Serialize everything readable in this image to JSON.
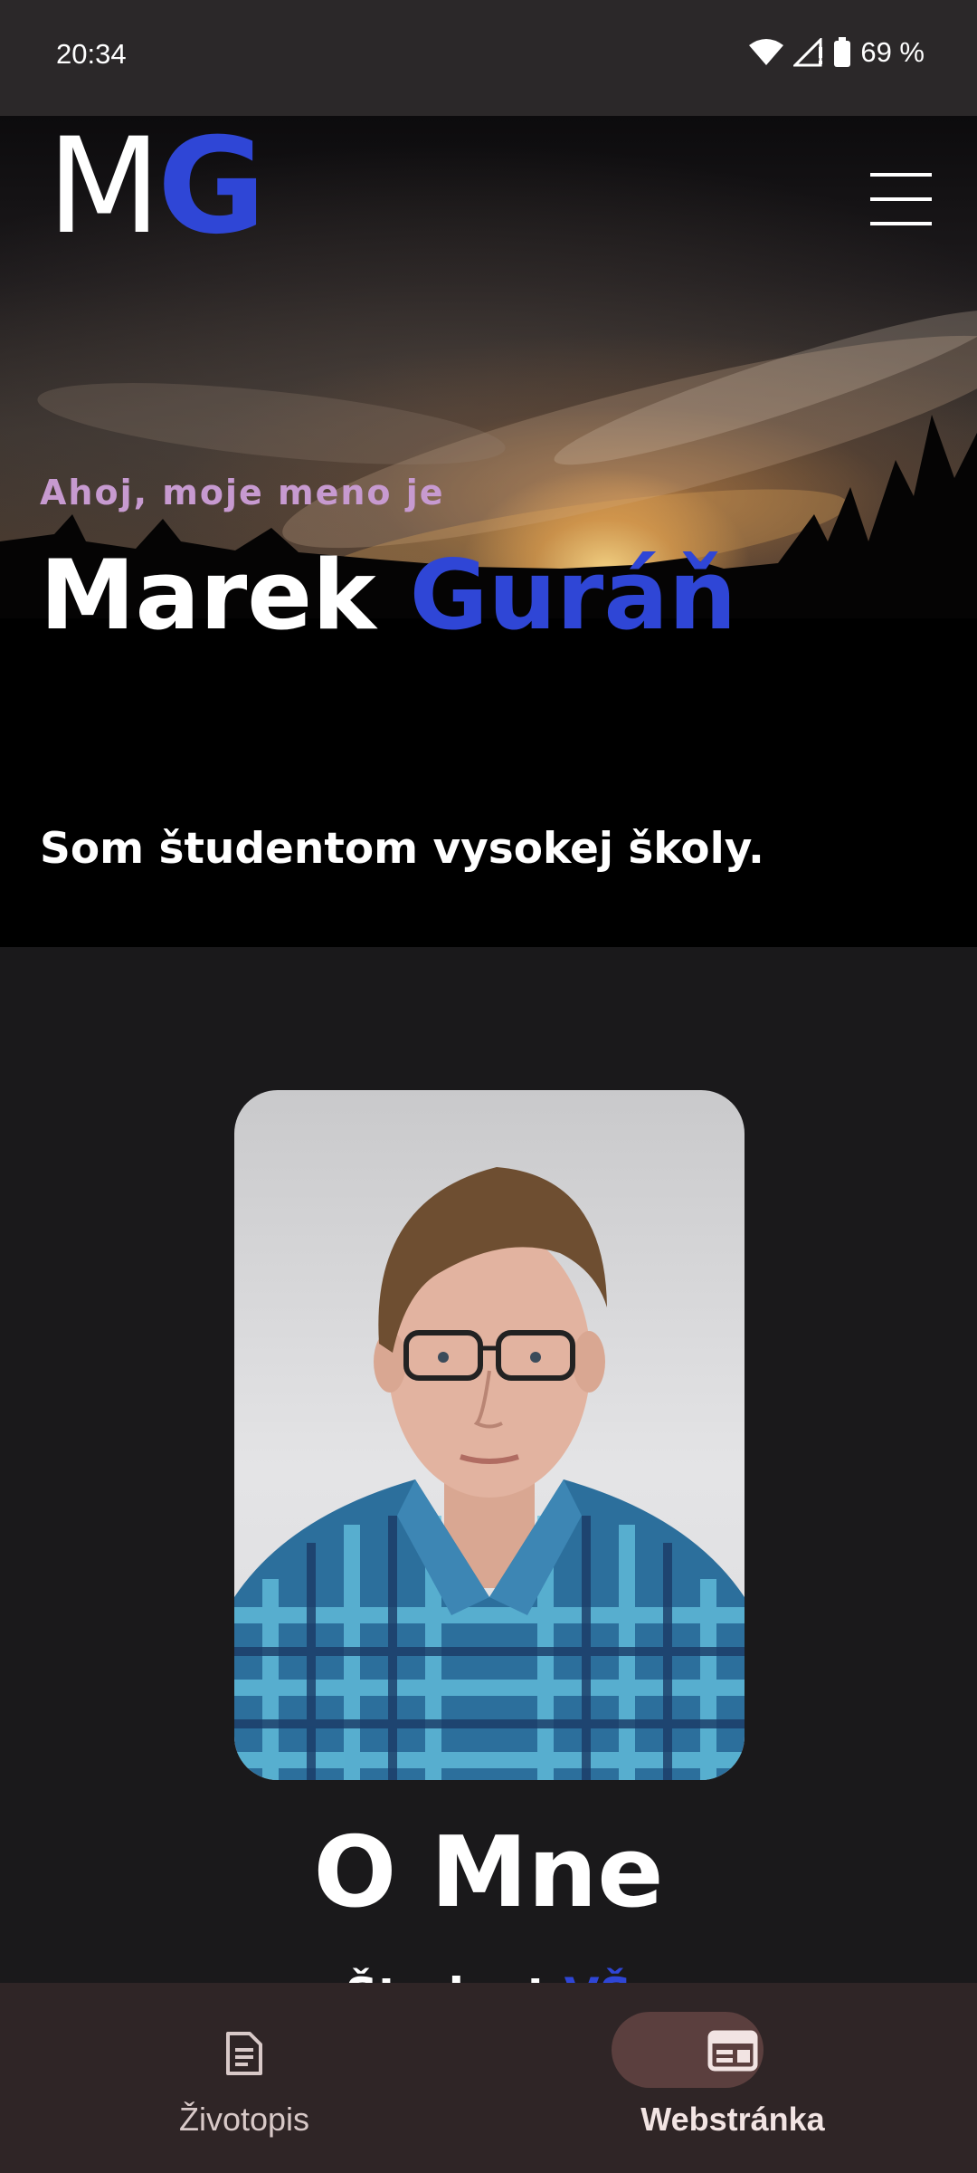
{
  "status_bar": {
    "time": "20:34",
    "battery": "69 %",
    "icons": [
      "wifi-icon",
      "signal-icon",
      "battery-icon"
    ]
  },
  "header": {
    "logo_left": "M",
    "logo_right": "G",
    "menu_icon": "hamburger-menu-icon"
  },
  "hero": {
    "greeting": "Ahoj, moje meno je",
    "first_name": "Marek",
    "last_name": "Guráň",
    "tagline": "Som študentom vysokej školy."
  },
  "about": {
    "title": "O Mne",
    "subtitle_start": "Študent ",
    "subtitle_accent": "VŠ"
  },
  "bottom_nav": {
    "items": [
      {
        "label": "Životopis",
        "icon": "document-icon",
        "selected": false
      },
      {
        "label": "Webstránka",
        "icon": "web-page-icon",
        "selected": true
      }
    ]
  },
  "colors": {
    "accent": "#2f46d6",
    "greeting": "#c79ad0",
    "background": "#1a191b",
    "nav_background": "#2f2526",
    "nav_selected_pill": "#5b3f3e"
  }
}
